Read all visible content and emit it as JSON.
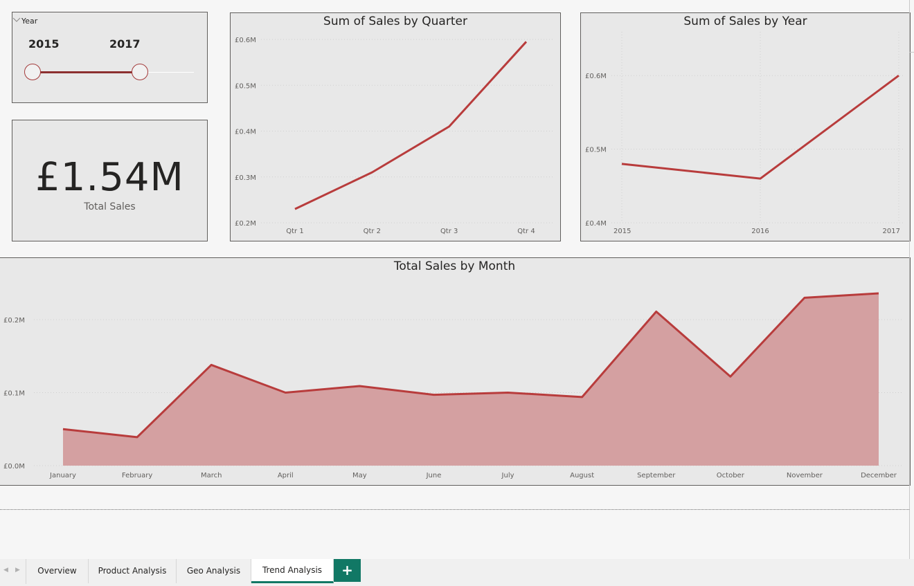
{
  "slicer": {
    "label": "Year",
    "start_value": "2015",
    "end_value": "2017",
    "range": [
      2015,
      2017
    ],
    "icon": "chevron-down-icon"
  },
  "kpi": {
    "value": "£1.54M",
    "label": "Total Sales"
  },
  "chart_data": [
    {
      "type": "line",
      "title": "Sum of Sales by Quarter",
      "categories": [
        "Qtr 1",
        "Qtr 2",
        "Qtr 3",
        "Qtr 4"
      ],
      "values": [
        0.23,
        0.31,
        0.41,
        0.595
      ],
      "yticks": [
        0.2,
        0.3,
        0.4,
        0.5,
        0.6
      ],
      "ytick_labels": [
        "£0.2M",
        "£0.3M",
        "£0.4M",
        "£0.5M",
        "£0.6M"
      ],
      "ylim": [
        0.2,
        0.6
      ],
      "unit": "£M",
      "grid": true,
      "color": "#b83c3c"
    },
    {
      "type": "line",
      "title": "Sum of Sales by Year",
      "categories": [
        "2015",
        "2016",
        "2017"
      ],
      "values": [
        0.48,
        0.46,
        0.6
      ],
      "yticks": [
        0.4,
        0.5,
        0.6
      ],
      "ytick_labels": [
        "£0.4M",
        "£0.5M",
        "£0.6M"
      ],
      "ylim": [
        0.4,
        0.65
      ],
      "unit": "£M",
      "grid": true,
      "color": "#b83c3c"
    },
    {
      "type": "area",
      "title": "Total Sales by Month",
      "categories": [
        "January",
        "February",
        "March",
        "April",
        "May",
        "June",
        "July",
        "August",
        "September",
        "October",
        "November",
        "December"
      ],
      "values": [
        0.05,
        0.039,
        0.138,
        0.1,
        0.109,
        0.097,
        0.1,
        0.094,
        0.211,
        0.122,
        0.23,
        0.236
      ],
      "yticks": [
        0.0,
        0.1,
        0.2
      ],
      "ytick_labels": [
        "£0.0M",
        "£0.1M",
        "£0.2M"
      ],
      "ylim": [
        0.0,
        0.2
      ],
      "unit": "£M",
      "grid": true,
      "color": "#b83c3c",
      "fill_color": "#d4a0a1"
    }
  ],
  "tabs": {
    "items": [
      {
        "label": "Overview",
        "active": false
      },
      {
        "label": "Product Analysis",
        "active": false
      },
      {
        "label": "Geo Analysis",
        "active": false
      },
      {
        "label": "Trend Analysis",
        "active": true
      }
    ],
    "add_label": "+",
    "prev_icon": "chevron-left-icon",
    "next_icon": "chevron-right-icon"
  }
}
